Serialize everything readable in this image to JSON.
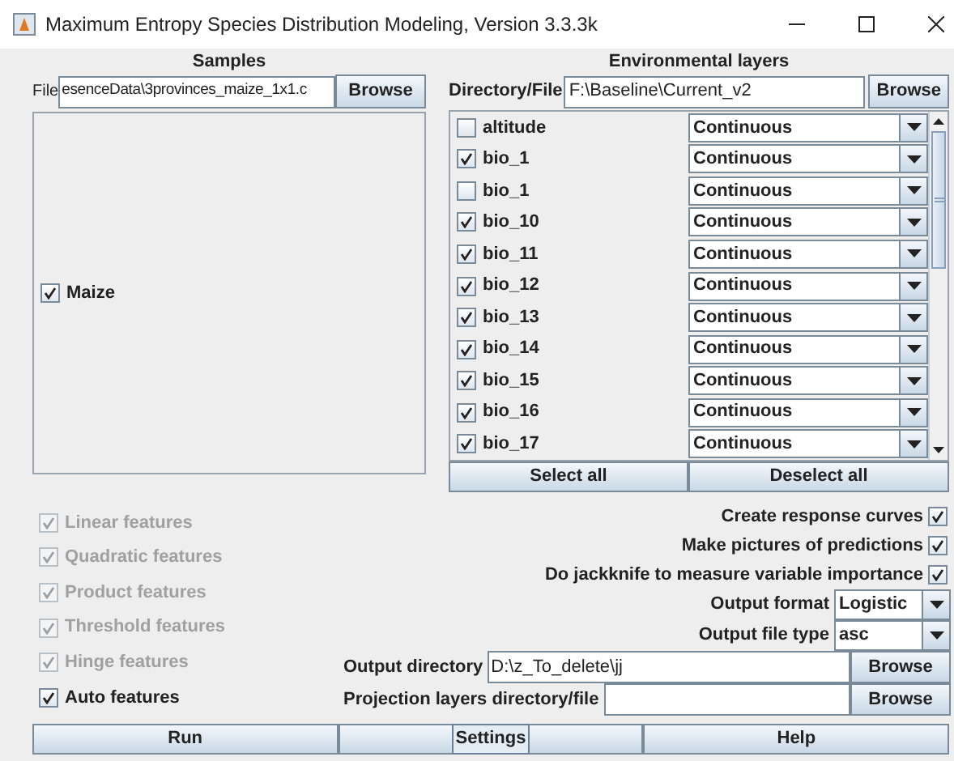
{
  "window": {
    "title": "Maximum Entropy Species Distribution Modeling, Version 3.3.3k"
  },
  "samples": {
    "title": "Samples",
    "file_label": "File",
    "file_value": "esenceData\\3provinces_maize_1x1.c",
    "browse": "Browse",
    "species": [
      {
        "label": "Maize",
        "checked": true
      }
    ]
  },
  "environmental_layers": {
    "title": "Environmental layers",
    "dir_label": "Directory/File",
    "dir_value": "F:\\Baseline\\Current_v2",
    "browse": "Browse",
    "layers": [
      {
        "name": "altitude",
        "checked": false,
        "type": "Continuous"
      },
      {
        "name": "bio_1",
        "checked": true,
        "type": "Continuous"
      },
      {
        "name": "bio_1",
        "checked": false,
        "type": "Continuous"
      },
      {
        "name": "bio_10",
        "checked": true,
        "type": "Continuous"
      },
      {
        "name": "bio_11",
        "checked": true,
        "type": "Continuous"
      },
      {
        "name": "bio_12",
        "checked": true,
        "type": "Continuous"
      },
      {
        "name": "bio_13",
        "checked": true,
        "type": "Continuous"
      },
      {
        "name": "bio_14",
        "checked": true,
        "type": "Continuous"
      },
      {
        "name": "bio_15",
        "checked": true,
        "type": "Continuous"
      },
      {
        "name": "bio_16",
        "checked": true,
        "type": "Continuous"
      },
      {
        "name": "bio_17",
        "checked": true,
        "type": "Continuous"
      }
    ],
    "select_all": "Select all",
    "deselect_all": "Deselect all"
  },
  "features": [
    {
      "label": "Linear features",
      "checked": true,
      "disabled": true
    },
    {
      "label": "Quadratic features",
      "checked": true,
      "disabled": true
    },
    {
      "label": "Product features",
      "checked": true,
      "disabled": true
    },
    {
      "label": "Threshold features",
      "checked": true,
      "disabled": true
    },
    {
      "label": "Hinge features",
      "checked": true,
      "disabled": true
    },
    {
      "label": "Auto features",
      "checked": true,
      "disabled": false
    }
  ],
  "options": [
    {
      "label": "Create response curves",
      "checked": true
    },
    {
      "label": "Make pictures of predictions",
      "checked": true
    },
    {
      "label": "Do jackknife to measure variable importance",
      "checked": true
    }
  ],
  "output_format": {
    "label": "Output format",
    "value": "Logistic"
  },
  "output_file_type": {
    "label": "Output file type",
    "value": "asc"
  },
  "output_directory": {
    "label": "Output directory",
    "value": "D:\\z_To_delete\\jj",
    "browse": "Browse"
  },
  "projection_layers": {
    "label": "Projection layers directory/file",
    "browse": "Browse"
  },
  "buttons": [
    {
      "label": "Run",
      "focused": false
    },
    {
      "label": "Settings",
      "focused": true
    },
    {
      "label": "Help",
      "focused": false
    }
  ]
}
